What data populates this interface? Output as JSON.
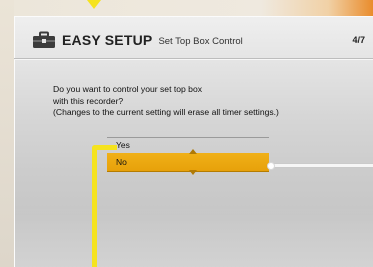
{
  "header": {
    "title": "EASY SETUP",
    "subtitle": "Set Top Box Control",
    "page_indicator": "4/7",
    "icon": "toolbox-icon"
  },
  "question": {
    "line1": "Do you want to control your set top box",
    "line2": "with this recorder?",
    "line3": "(Changes to the current setting will erase all timer settings.)"
  },
  "options": [
    {
      "label": "Yes",
      "selected": false
    },
    {
      "label": "No",
      "selected": true
    }
  ],
  "colors": {
    "highlight": "#e9a60f",
    "bracket": "#f5e31f",
    "accent_orange": "#e98c2c"
  }
}
